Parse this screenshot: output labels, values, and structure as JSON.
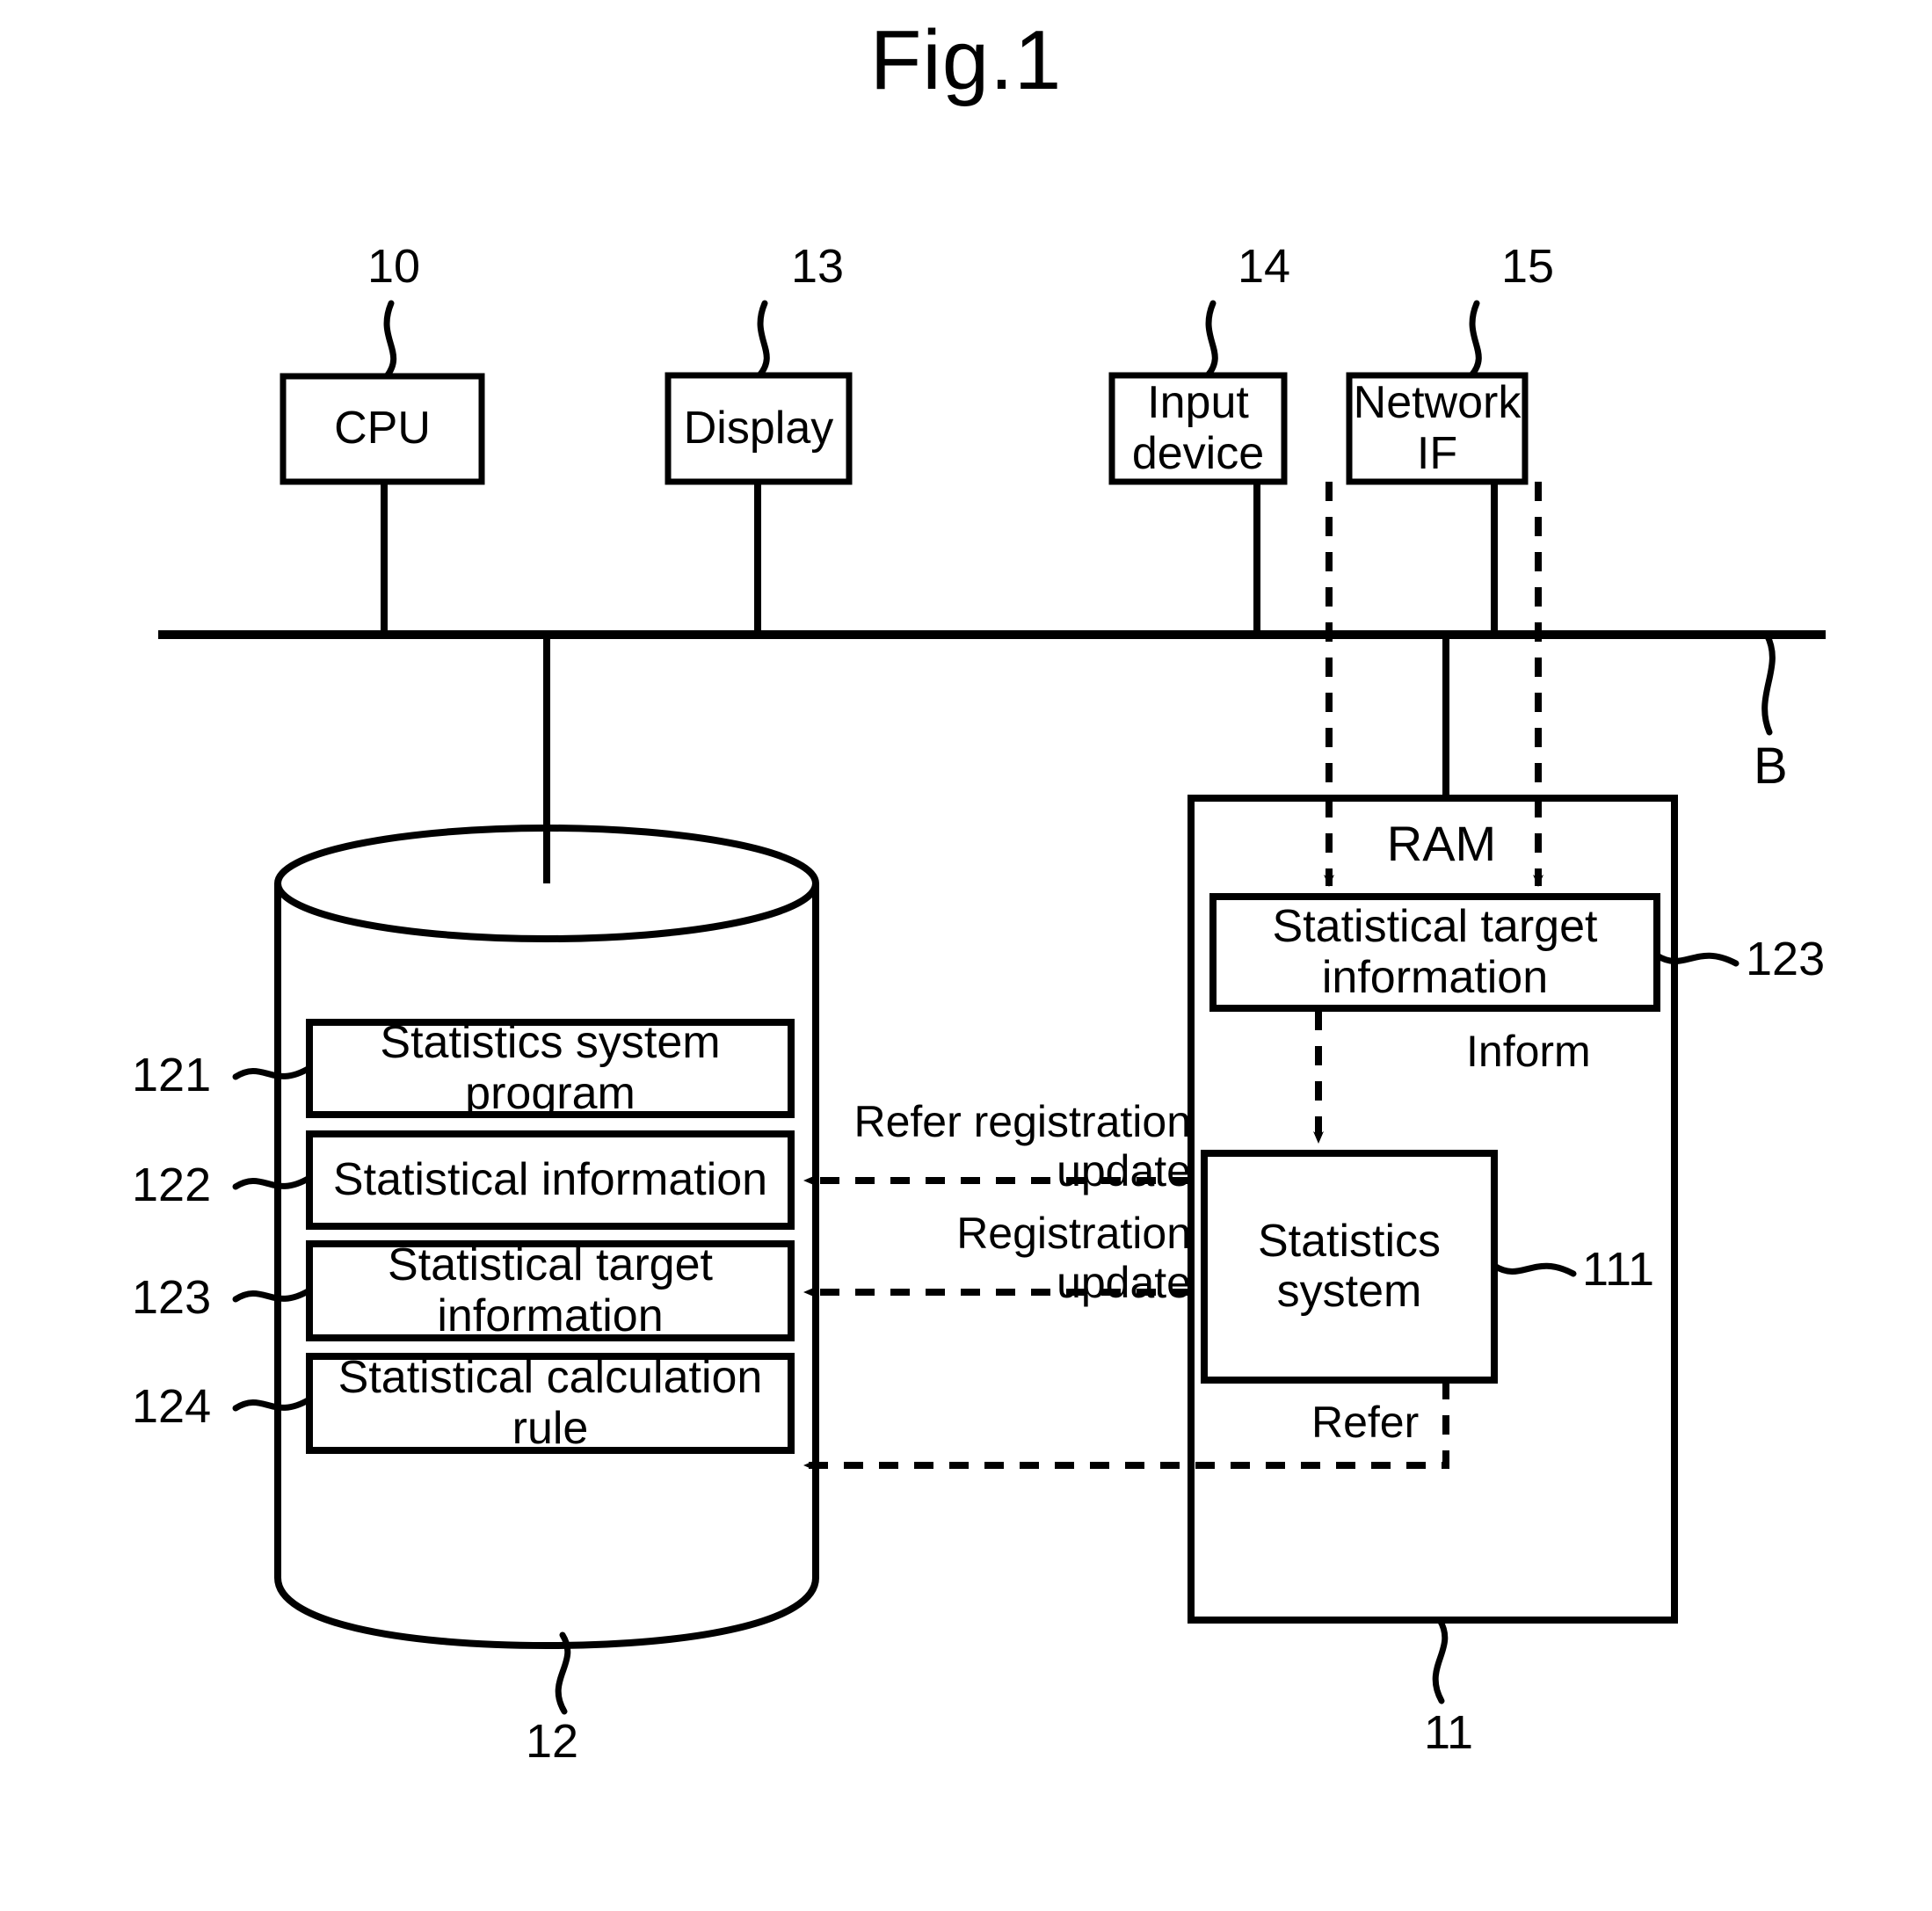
{
  "figure": {
    "title": "Fig.1"
  },
  "bus": {
    "label": "B"
  },
  "top_components": [
    {
      "label": "CPU",
      "ref": "10"
    },
    {
      "label": "Display",
      "ref": "13"
    },
    {
      "label": "Input device",
      "ref": "14"
    },
    {
      "label": "Network IF",
      "ref": "15"
    }
  ],
  "storage": {
    "ref": "12",
    "items": [
      {
        "ref": "121",
        "label": "Statistics system program"
      },
      {
        "ref": "122",
        "label": "Statistical information"
      },
      {
        "ref": "123",
        "label": "Statistical target information"
      },
      {
        "ref": "124",
        "label": "Statistical calculation rule"
      }
    ]
  },
  "ram": {
    "label": "RAM",
    "ref": "11",
    "target_info": {
      "label": "Statistical target information",
      "ref": "123"
    },
    "statistics_system": {
      "label": "Statistics system",
      "ref": "111"
    }
  },
  "flow_labels": {
    "inform": "Inform",
    "refer_registration_update": "Refer registration\nupdate",
    "registration_update": "Registration\nupdate",
    "refer": "Refer"
  }
}
